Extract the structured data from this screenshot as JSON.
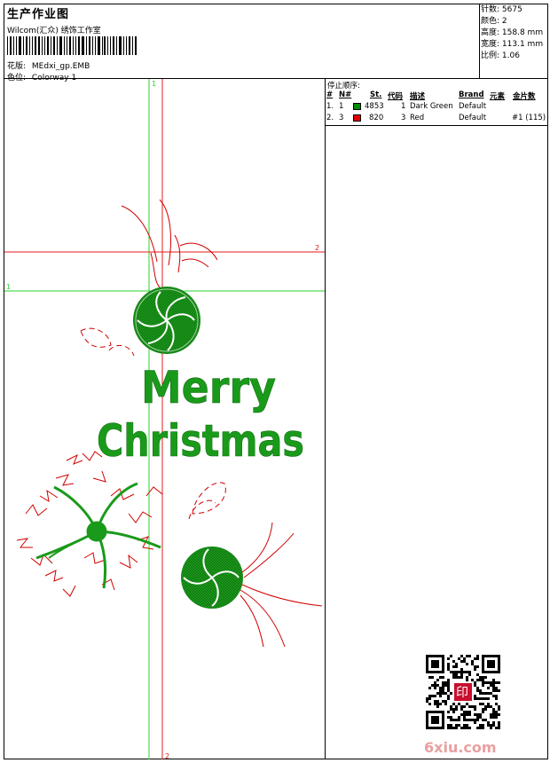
{
  "header": {
    "title": "生产作业图",
    "company": "Wilcom(汇众) 绣饰工作室",
    "file_label": "花版:",
    "file_value": "MEdxi_gp.EMB",
    "colorway_label": "色位:",
    "colorway_value": "Colorway 1"
  },
  "stats": {
    "stitches_label": "针数:",
    "stitches": "5675",
    "colors_label": "颜色:",
    "colors": "2",
    "height_label": "高度:",
    "height": "158.8 mm",
    "width_label": "宽度:",
    "width": "113.1 mm",
    "scale_label": "比例:",
    "scale": "1.06"
  },
  "stop_sequence": {
    "title": "停止顺序:",
    "headers": [
      "#",
      "N#",
      "St.",
      "代码",
      "描述",
      "Brand",
      "元素",
      "金片数"
    ],
    "rows": [
      {
        "idx": "1.",
        "n": "1",
        "color": "#008c00",
        "stitches": "4853",
        "code": "1",
        "desc": "Dark Green",
        "brand": "Default",
        "element": "",
        "sequin": ""
      },
      {
        "idx": "2.",
        "n": "3",
        "color": "#e00000",
        "stitches": "820",
        "code": "3",
        "desc": "Red",
        "brand": "Default",
        "element": "",
        "sequin": "#1 (115)"
      }
    ]
  },
  "design": {
    "line1": "Merry",
    "line2": "Christmas",
    "green": "#1a9a1a",
    "red": "#d20000",
    "guide_green": "#2bd52b",
    "guide_red": "#e21b1b",
    "marker_v_green": "1",
    "marker_h_red": "2",
    "marker_h_green": "1",
    "marker_v_red": "2"
  },
  "watermark": {
    "text": "6xiu.com",
    "stamp_char": "印"
  }
}
